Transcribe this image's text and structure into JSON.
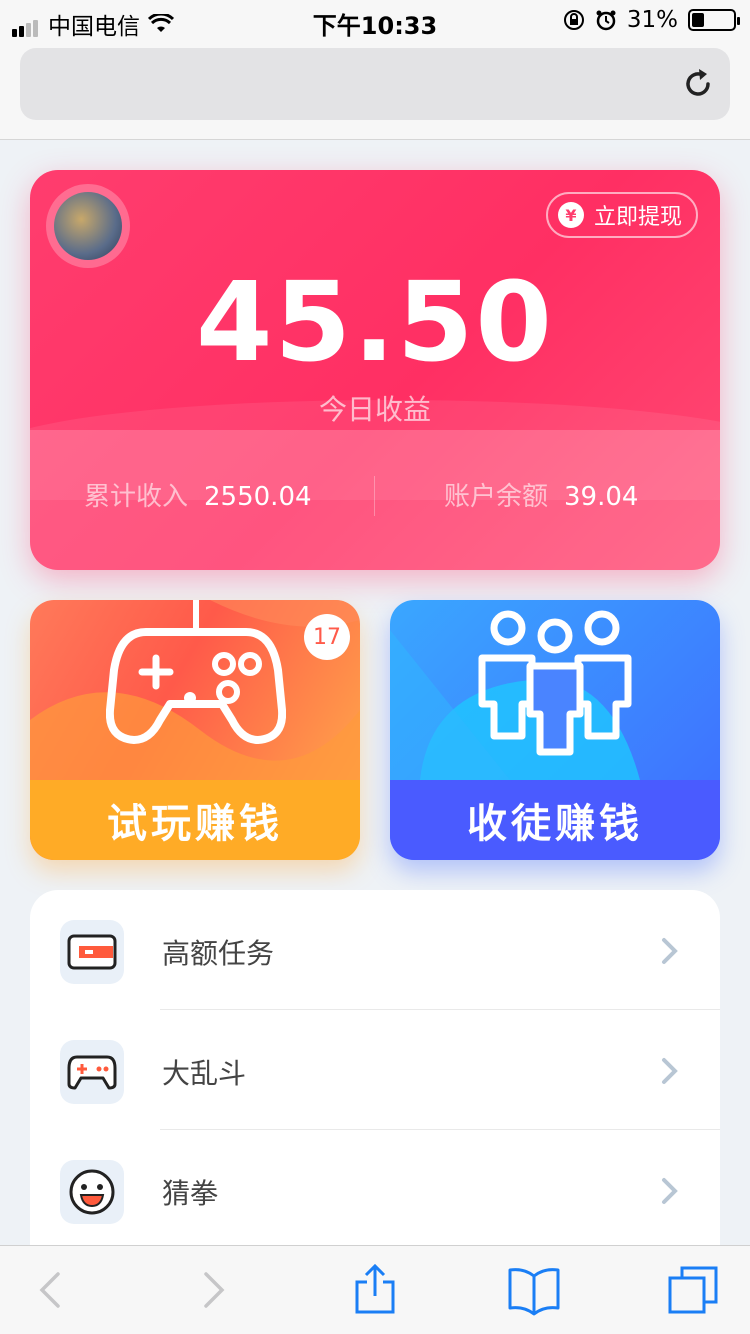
{
  "status_bar": {
    "carrier": "中国电信",
    "time": "下午10:33",
    "battery_percent": "31%",
    "battery_level": 0.31
  },
  "browser": {
    "url_text": "",
    "reload_icon": "reload-icon"
  },
  "earnings_card": {
    "withdraw_label": "立即提现",
    "yen_symbol": "¥",
    "today_amount": "45.50",
    "today_label": "今日收益",
    "total_label": "累计收入",
    "total_value": "2550.04",
    "balance_label": "账户余额",
    "balance_value": "39.04",
    "gradient_color": "#ff3d6e"
  },
  "tiles": {
    "play": {
      "label": "试玩赚钱",
      "badge": "17",
      "icon": "gamepad-icon",
      "color": "#ffab26"
    },
    "recruit": {
      "label": "收徒赚钱",
      "icon": "people-icon",
      "color": "#4a5bff"
    }
  },
  "menu": {
    "items": [
      {
        "label": "高额任务",
        "icon": "card-icon"
      },
      {
        "label": "大乱斗",
        "icon": "gamepad-icon"
      },
      {
        "label": "猜拳",
        "icon": "smiley-icon"
      }
    ]
  },
  "toolbar": {
    "icons": [
      "back-icon",
      "forward-icon",
      "share-icon",
      "bookmarks-icon",
      "tabs-icon"
    ]
  }
}
